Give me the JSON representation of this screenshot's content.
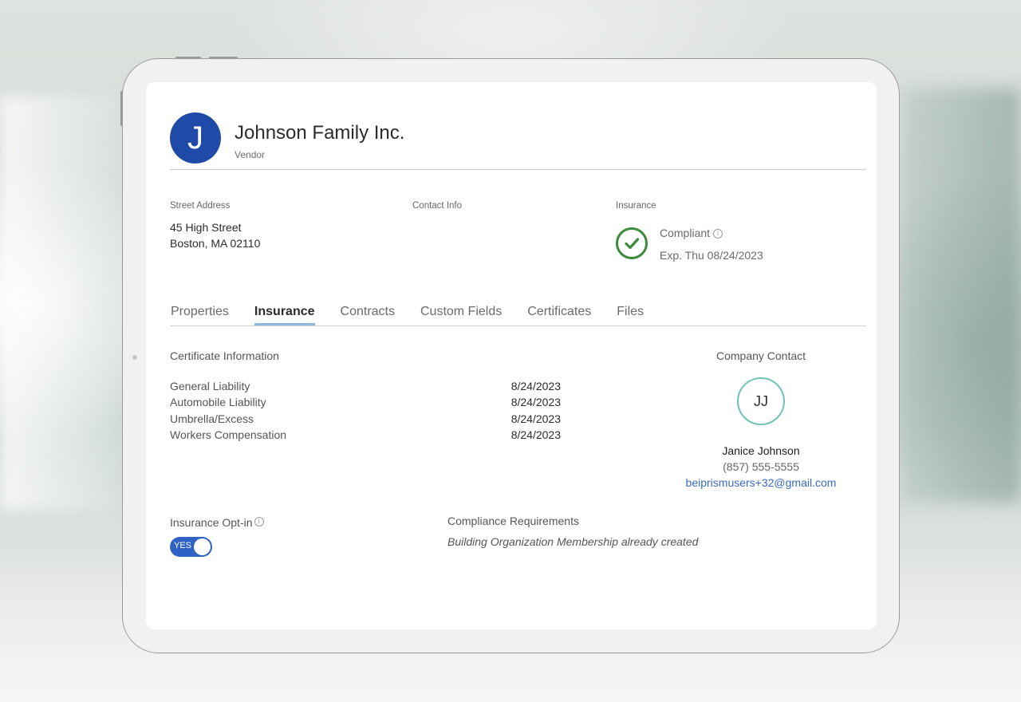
{
  "company": {
    "initial": "J",
    "name": "Johnson Family Inc.",
    "type": "Vendor"
  },
  "address": {
    "label": "Street Address",
    "line1": "45 High Street",
    "line2": "Boston, MA 02110"
  },
  "contact_info": {
    "label": "Contact Info"
  },
  "insurance_status": {
    "label": "Insurance",
    "status": "Compliant",
    "info_glyph": "i",
    "expiration": "Exp. Thu 08/24/2023",
    "status_color": "#3d8a3c"
  },
  "tabs": [
    {
      "label": "Properties",
      "active": false
    },
    {
      "label": "Insurance",
      "active": true
    },
    {
      "label": "Contracts",
      "active": false
    },
    {
      "label": "Custom Fields",
      "active": false
    },
    {
      "label": "Certificates",
      "active": false
    },
    {
      "label": "Files",
      "active": false
    }
  ],
  "certificate_info": {
    "title": "Certificate Information",
    "rows": [
      {
        "name": "General Liability",
        "date": "8/24/2023"
      },
      {
        "name": "Automobile Liability",
        "date": "8/24/2023"
      },
      {
        "name": "Umbrella/Excess",
        "date": "8/24/2023"
      },
      {
        "name": "Workers Compensation",
        "date": "8/24/2023"
      }
    ]
  },
  "company_contact": {
    "title": "Company Contact",
    "initials": "JJ",
    "name": "Janice Johnson",
    "phone": "(857) 555-5555",
    "email": "beiprismusers+32@gmail.com"
  },
  "insurance_optin": {
    "label": "Insurance Opt-in",
    "toggle_label": "YES",
    "enabled": true
  },
  "compliance": {
    "title": "Compliance Requirements",
    "text": "Building Organization Membership already created"
  },
  "colors": {
    "brand_blue": "#1f4aa8",
    "toggle_blue": "#2f62c4",
    "tab_underline": "#8db8e0",
    "avatar_ring": "#6fc4b6",
    "link": "#3a6bc4"
  }
}
